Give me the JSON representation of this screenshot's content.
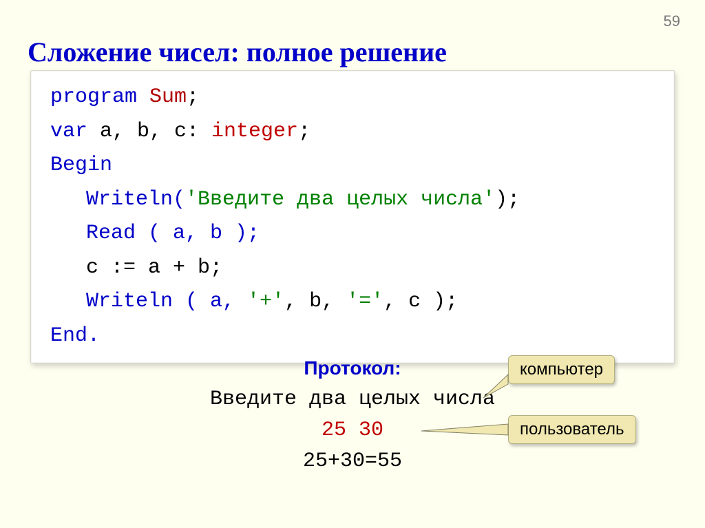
{
  "page_number": "59",
  "title": "Сложение чисел: полное решение",
  "code": {
    "l1a": "program ",
    "l1b": "Sum",
    "l1c": ";",
    "l2a": "var ",
    "l2b": "a, b, c: ",
    "l2c": "integer",
    "l2d": ";",
    "l3": "Begin",
    "l4a": "Writeln(",
    "l4b": "'Введите два целых числа'",
    "l4c": ");",
    "l5": "Read ( a, b );",
    "l6": "c := a + b;",
    "l7a": "Writeln ( a, ",
    "l7b": "'+'",
    "l7c": ", b, ",
    "l7d": "'='",
    "l7e": ", c );",
    "l8": "End."
  },
  "protocol": {
    "label": "Протокол:",
    "line1": "Введите два целых числа",
    "line2": "25 30",
    "line3": "25+30=55"
  },
  "callouts": {
    "computer": "компьютер",
    "user": "пользователь"
  }
}
